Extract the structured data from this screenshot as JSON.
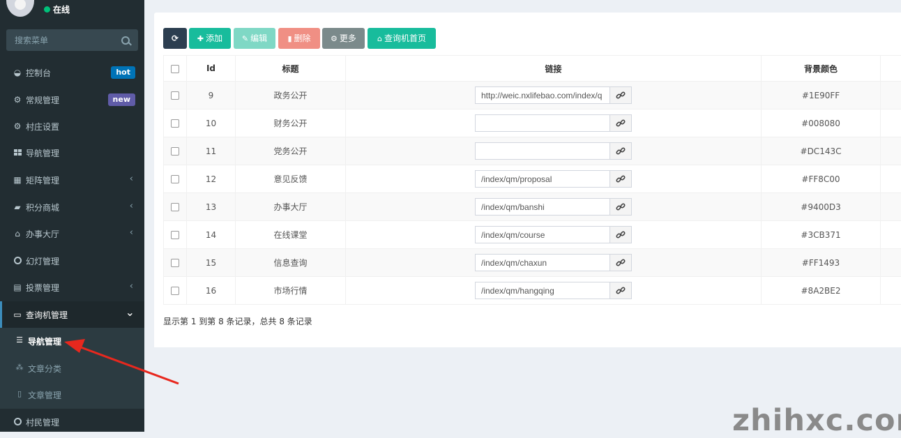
{
  "user": {
    "status": "在线"
  },
  "search": {
    "placeholder": "搜索菜单"
  },
  "sidebar": {
    "items": [
      {
        "label": "控制台",
        "icon": "dashboard-icon",
        "badge": "hot",
        "badge_color": "#0073b7"
      },
      {
        "label": "常规管理",
        "icon": "cogs-icon",
        "badge": "new",
        "badge_color": "#605ca8"
      },
      {
        "label": "村庄设置",
        "icon": "cogs-icon"
      },
      {
        "label": "导航管理",
        "icon": "th-large-icon"
      },
      {
        "label": "矩阵管理",
        "icon": "th-icon",
        "caret": "‹"
      },
      {
        "label": "积分商城",
        "icon": "shopping-bag-icon",
        "caret": "‹"
      },
      {
        "label": "办事大厅",
        "icon": "bank-icon",
        "caret": "‹"
      },
      {
        "label": "幻灯管理",
        "icon": "circle-icon"
      },
      {
        "label": "投票管理",
        "icon": "id-card-icon",
        "caret": "‹"
      },
      {
        "label": "查询机管理",
        "icon": "laptop-icon",
        "caret": "⌄",
        "active": true
      },
      {
        "label": "村民管理",
        "icon": "circle-icon"
      }
    ],
    "submenu": [
      {
        "label": "导航管理",
        "icon": "list-icon",
        "active": true
      },
      {
        "label": "文章分类",
        "icon": "sitemap-icon"
      },
      {
        "label": "文章管理",
        "icon": "file-icon"
      }
    ]
  },
  "toolbar": {
    "refresh_icon": "refresh-icon",
    "add_label": "添加",
    "edit_label": "编辑",
    "delete_label": "删除",
    "more_label": "更多",
    "home_label": "查询机首页"
  },
  "table": {
    "headers": {
      "id": "Id",
      "title": "标题",
      "link": "链接",
      "bg_color": "背景颜色"
    },
    "rows": [
      {
        "id": "9",
        "title": "政务公开",
        "link": "http://weic.nxlifebao.com/index/q",
        "bg_color": "#1E90FF"
      },
      {
        "id": "10",
        "title": "财务公开",
        "link": "",
        "bg_color": "#008080"
      },
      {
        "id": "11",
        "title": "党务公开",
        "link": "",
        "bg_color": "#DC143C"
      },
      {
        "id": "12",
        "title": "意见反馈",
        "link": "/index/qm/proposal",
        "bg_color": "#FF8C00"
      },
      {
        "id": "13",
        "title": "办事大厅",
        "link": "/index/qm/banshi",
        "bg_color": "#9400D3"
      },
      {
        "id": "14",
        "title": "在线课堂",
        "link": "/index/qm/course",
        "bg_color": "#3CB371"
      },
      {
        "id": "15",
        "title": "信息查询",
        "link": "/index/qm/chaxun",
        "bg_color": "#FF1493"
      },
      {
        "id": "16",
        "title": "市场行情",
        "link": "/index/qm/hangqing",
        "bg_color": "#8A2BE2"
      }
    ]
  },
  "pager": {
    "info": "显示第 1 到第 8 条记录，总共 8 条记录"
  },
  "watermark": "zhihxc.com"
}
